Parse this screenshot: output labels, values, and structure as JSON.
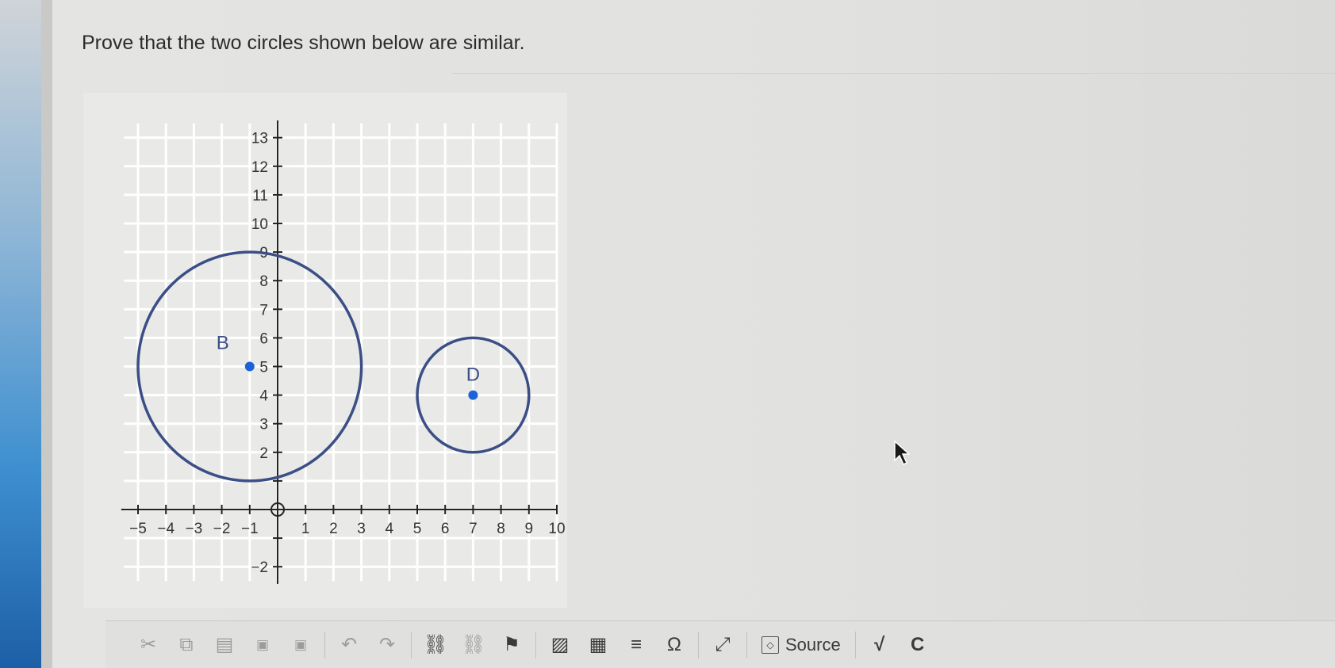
{
  "question": "Prove that the two circles shown below are similar.",
  "graph": {
    "x_tick_labels": [
      "−5",
      "−4",
      "−3",
      "−2",
      "−1",
      "1",
      "2",
      "3",
      "4",
      "5",
      "6",
      "7",
      "8",
      "9",
      "10"
    ],
    "y_tick_labels": [
      "−2",
      "2",
      "3",
      "4",
      "5",
      "6",
      "7",
      "8",
      "9",
      "10",
      "11",
      "12",
      "13"
    ],
    "circle_b": {
      "label": "B",
      "center": [
        -1,
        5
      ],
      "radius": 4
    },
    "circle_d": {
      "label": "D",
      "center": [
        7,
        4
      ],
      "radius": 2
    },
    "colors": {
      "circle": "#3b4f86",
      "point": "#1c63d8",
      "grid": "#ffffff"
    }
  },
  "toolbar": {
    "buttons": [
      {
        "name": "cut-icon",
        "glyph": "✂"
      },
      {
        "name": "copy-icon",
        "glyph": "⧉"
      },
      {
        "name": "paste-icon",
        "glyph": "📋"
      },
      {
        "name": "paste-text-icon",
        "glyph": "T"
      },
      {
        "name": "paste-word-icon",
        "glyph": "W"
      },
      {
        "name": "undo-icon",
        "glyph": "↶"
      },
      {
        "name": "redo-icon",
        "glyph": "↷"
      },
      {
        "name": "link-icon",
        "glyph": "⛓"
      },
      {
        "name": "unlink-icon",
        "glyph": "⛓"
      },
      {
        "name": "anchor-flag-icon",
        "glyph": "⚑"
      },
      {
        "name": "image-icon",
        "glyph": "🖼"
      },
      {
        "name": "table-icon",
        "glyph": "▦"
      },
      {
        "name": "horizontal-line-icon",
        "glyph": "≡"
      },
      {
        "name": "special-char-icon",
        "glyph": "Ω"
      },
      {
        "name": "maximize-icon",
        "glyph": "⤢"
      }
    ],
    "source_label": "Source"
  }
}
